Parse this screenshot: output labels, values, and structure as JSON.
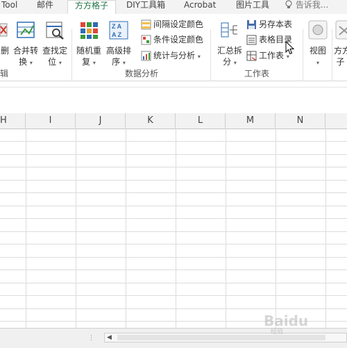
{
  "tabs": [
    {
      "label": "Tool",
      "active": false
    },
    {
      "label": "邮件",
      "active": false
    },
    {
      "label": "方方格子",
      "active": true
    },
    {
      "label": "DIY工具箱",
      "active": false
    },
    {
      "label": "Acrobat",
      "active": false
    },
    {
      "label": "图片工具",
      "active": false
    },
    {
      "label": "告诉我...",
      "active": false
    }
  ],
  "ribbon": {
    "partial_left": {
      "line1": "删",
      "line2": "▾"
    },
    "merge_convert": {
      "line1": "合并转",
      "line2": "换"
    },
    "find_locate": {
      "line1": "查找定",
      "line2": "位"
    },
    "random_repeat": {
      "line1": "随机重",
      "line2": "复"
    },
    "advanced_sort": {
      "line1": "高级排",
      "line2": "序"
    },
    "interval_color": "间隔设定颜色",
    "conditional_color": "条件设定颜色",
    "stats_analysis": "统计与分析",
    "summary_split": {
      "line1": "汇总拆",
      "line2": "分"
    },
    "save_sheet": "另存本表",
    "sheet_directory": "表格目录",
    "worksheet": "工作表",
    "view": {
      "line1": "视图"
    },
    "fangfang_partial": {
      "line1": "方方",
      "line2": "子"
    },
    "group_left_partial": "辑",
    "group_data_analysis": "数据分析",
    "group_worksheet": "工作表"
  },
  "columns": [
    "H",
    "I",
    "J",
    "K",
    "L",
    "M",
    "N"
  ],
  "watermark": {
    "text": "Baidu",
    "sub": "经验"
  },
  "colors": {
    "accent": "#217346",
    "tab_bg": "#f3f3f3",
    "grid_line": "#dcdcdc",
    "header_bg": "#f2f2f2"
  }
}
